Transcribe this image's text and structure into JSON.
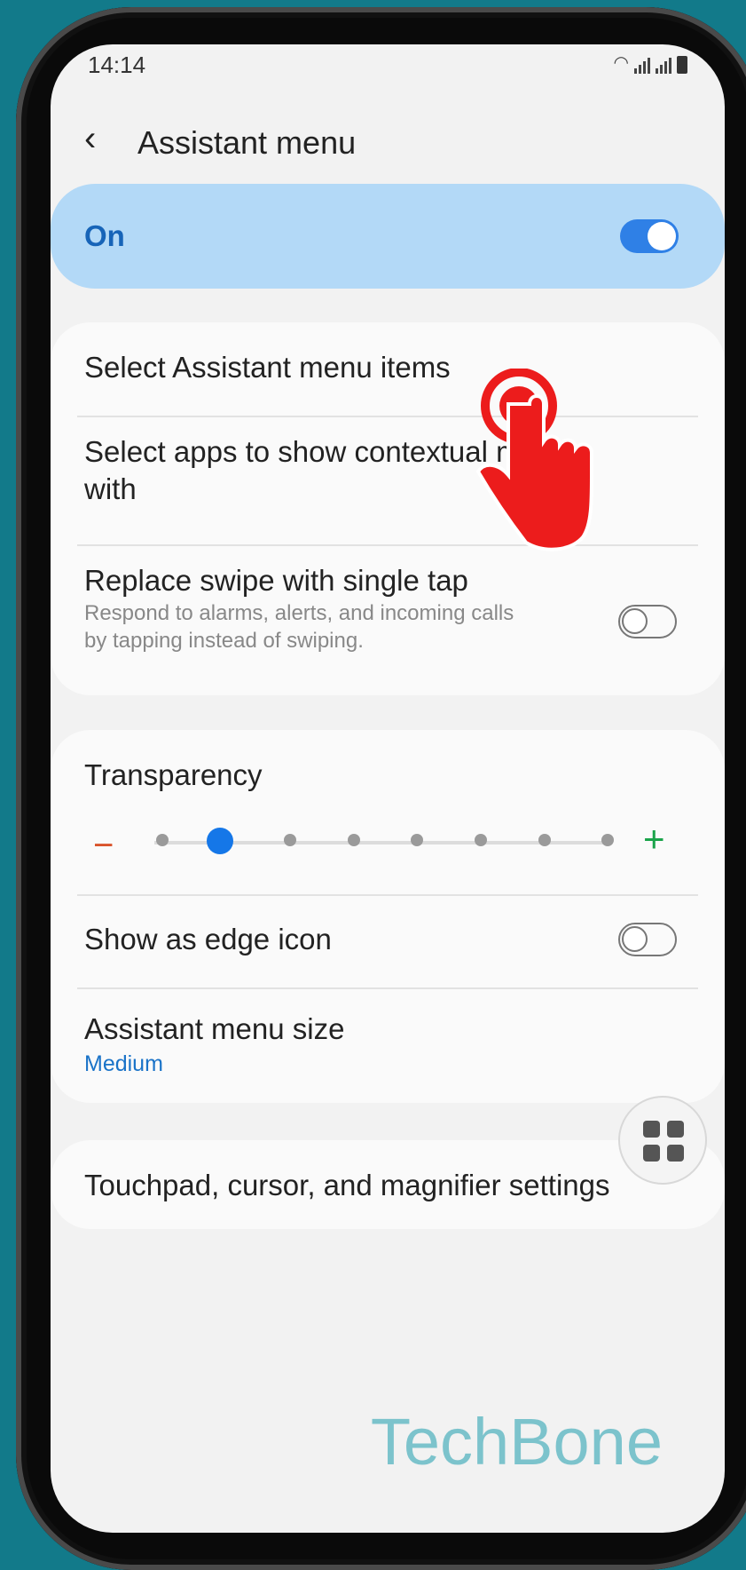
{
  "status": {
    "time": "14:14"
  },
  "header": {
    "title": "Assistant menu"
  },
  "master": {
    "label": "On",
    "enabled": true
  },
  "group1": {
    "select_items": "Select Assistant menu items",
    "select_apps": "Select apps to show contextual menus",
    "select_apps_line2": "with",
    "replace_swipe": {
      "title": "Replace swipe with single tap",
      "subtitle": "Respond to alarms, alerts, and incoming calls",
      "subtitle_line2": "by tapping instead of swiping.",
      "enabled": false
    }
  },
  "group2": {
    "transparency": {
      "title": "Transparency",
      "levels": 8,
      "selected": 1
    },
    "edge_icon": {
      "title": "Show as edge icon",
      "enabled": false
    },
    "menu_size": {
      "title": "Assistant menu size",
      "value": "Medium"
    }
  },
  "group3": {
    "touchpad": "Touchpad, cursor, and magnifier settings"
  },
  "watermark": "TechBone",
  "colors": {
    "accent": "#1577e8",
    "on_card": "#b3d9f7",
    "minus": "#d9532b",
    "plus": "#1aa34a",
    "tap_hand": "#ec1c1c"
  }
}
